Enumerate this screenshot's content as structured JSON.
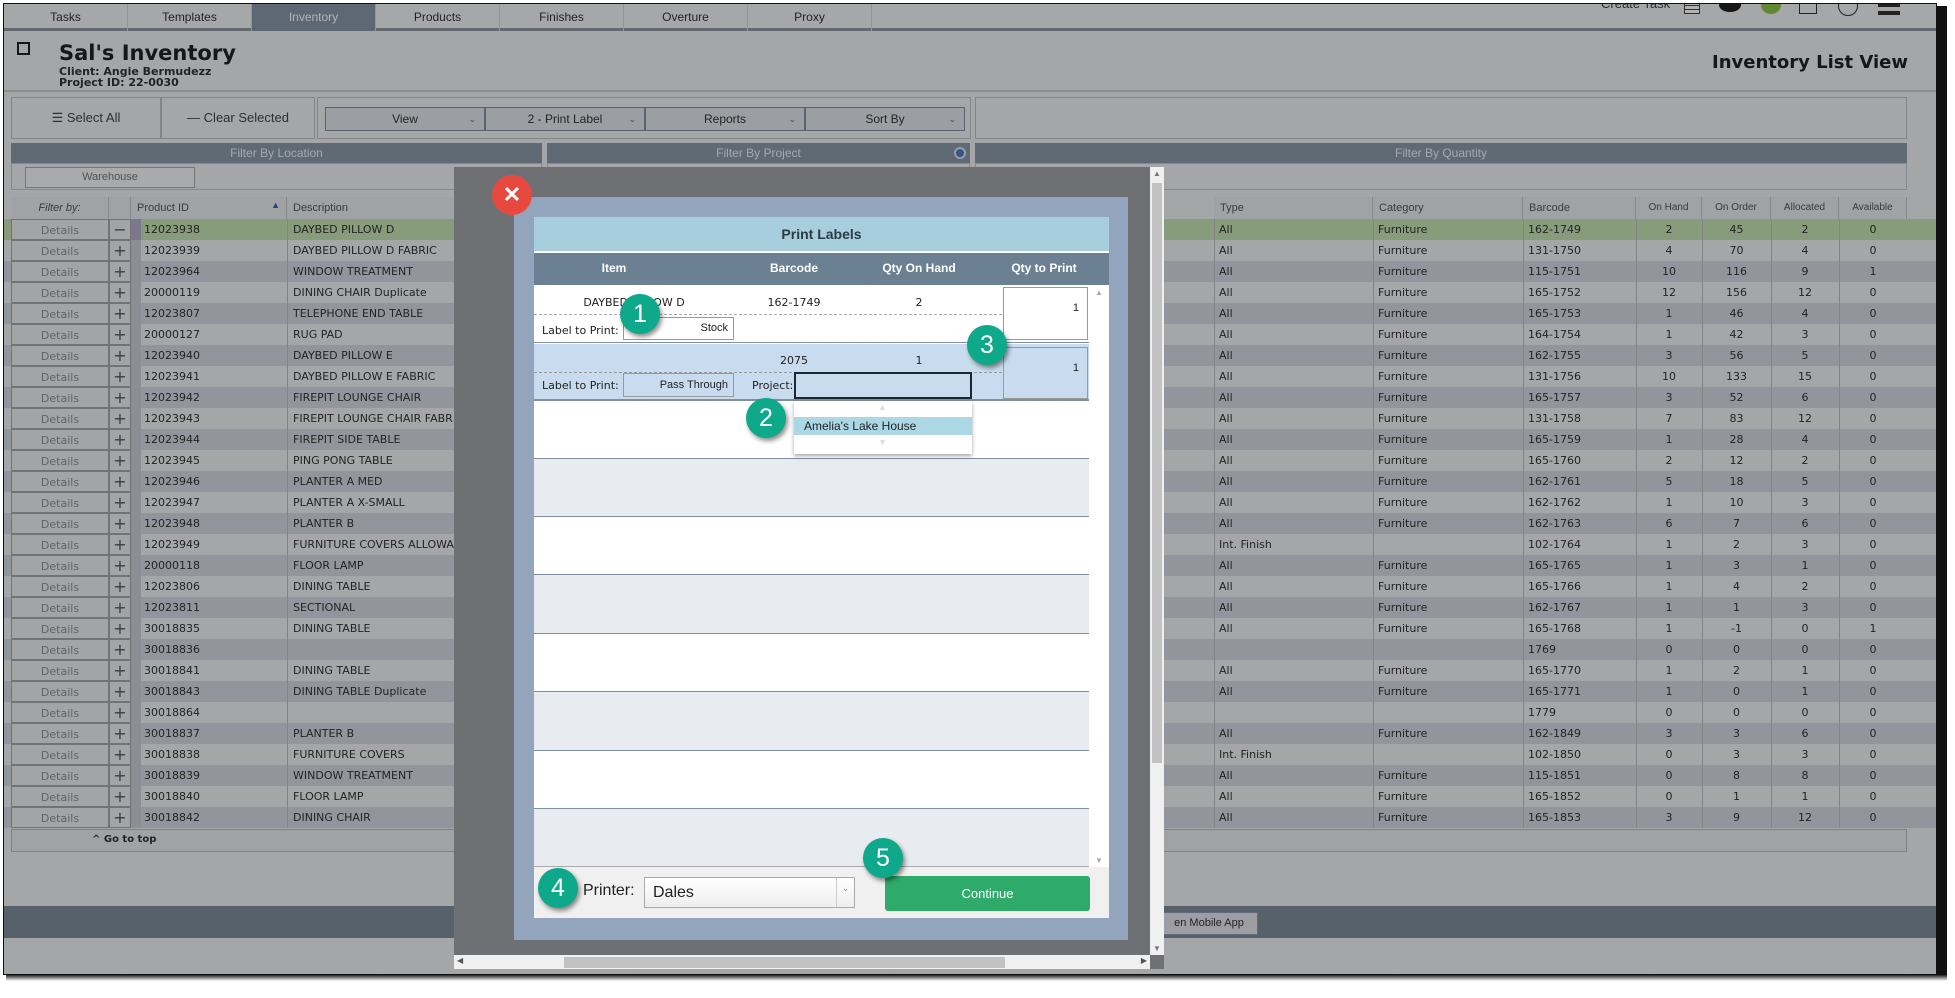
{
  "nav": {
    "tabs": [
      "Tasks",
      "Templates",
      "Inventory",
      "Products",
      "Finishes",
      "Overture",
      "Proxy"
    ],
    "active_tab": "Inventory",
    "create_task": "Create Task"
  },
  "header": {
    "title": "Sal's Inventory",
    "client": "Client: Angie Bermudezz",
    "project_id": "Project ID: 22-0030",
    "view_title": "Inventory List View"
  },
  "toolbar": {
    "select_all": "Select All",
    "clear_selected": "Clear Selected",
    "dropdowns": [
      "View",
      "2 - Print Label",
      "Reports",
      "Sort By"
    ]
  },
  "filters": {
    "location": "Filter By Location",
    "project": "Filter By Project",
    "quantity": "Filter By Quantity",
    "warehouse": "Warehouse"
  },
  "table": {
    "headers": {
      "filter_by": "Filter by:",
      "product_id": "Product ID",
      "description": "Description",
      "type": "Type",
      "category": "Category",
      "barcode": "Barcode",
      "on_hand": "On Hand",
      "on_order": "On Order",
      "allocated": "Allocated",
      "available": "Available"
    },
    "details_label": "Details",
    "go_to_top": "^ Go to top",
    "rows": [
      {
        "product_id": "12023938",
        "description": "DAYBED PILLOW D",
        "type": "All",
        "category": "Furniture",
        "barcode": "162-1749",
        "on_hand": "2",
        "on_order": "45",
        "allocated": "2",
        "available": "0",
        "selected": true
      },
      {
        "product_id": "12023939",
        "description": "DAYBED PILLOW D FABRIC",
        "type": "All",
        "category": "Furniture",
        "barcode": "131-1750",
        "on_hand": "4",
        "on_order": "70",
        "allocated": "4",
        "available": "0"
      },
      {
        "product_id": "12023964",
        "description": "WINDOW TREATMENT",
        "type": "All",
        "category": "Furniture",
        "barcode": "115-1751",
        "on_hand": "10",
        "on_order": "116",
        "allocated": "9",
        "available": "1"
      },
      {
        "product_id": "20000119",
        "description": "DINING CHAIR Duplicate",
        "type": "All",
        "category": "Furniture",
        "barcode": "165-1752",
        "on_hand": "12",
        "on_order": "156",
        "allocated": "12",
        "available": "0"
      },
      {
        "product_id": "12023807",
        "description": "TELEPHONE END TABLE",
        "type": "All",
        "category": "Furniture",
        "barcode": "165-1753",
        "on_hand": "1",
        "on_order": "46",
        "allocated": "4",
        "available": "0"
      },
      {
        "product_id": "20000127",
        "description": "RUG PAD",
        "type": "All",
        "category": "Furniture",
        "barcode": "164-1754",
        "on_hand": "1",
        "on_order": "42",
        "allocated": "3",
        "available": "0"
      },
      {
        "product_id": "12023940",
        "description": "DAYBED PILLOW E",
        "type": "All",
        "category": "Furniture",
        "barcode": "162-1755",
        "on_hand": "3",
        "on_order": "56",
        "allocated": "5",
        "available": "0"
      },
      {
        "product_id": "12023941",
        "description": "DAYBED PILLOW E FABRIC",
        "type": "All",
        "category": "Furniture",
        "barcode": "131-1756",
        "on_hand": "10",
        "on_order": "133",
        "allocated": "15",
        "available": "0"
      },
      {
        "product_id": "12023942",
        "description": "FIREPIT LOUNGE CHAIR",
        "type": "All",
        "category": "Furniture",
        "barcode": "165-1757",
        "on_hand": "3",
        "on_order": "52",
        "allocated": "6",
        "available": "0"
      },
      {
        "product_id": "12023943",
        "description": "FIREPIT LOUNGE CHAIR FABR",
        "type": "All",
        "category": "Furniture",
        "barcode": "131-1758",
        "on_hand": "7",
        "on_order": "83",
        "allocated": "12",
        "available": "0"
      },
      {
        "product_id": "12023944",
        "description": "FIREPIT SIDE TABLE",
        "type": "All",
        "category": "Furniture",
        "barcode": "165-1759",
        "on_hand": "1",
        "on_order": "28",
        "allocated": "4",
        "available": "0"
      },
      {
        "product_id": "12023945",
        "description": "PING PONG TABLE",
        "type": "All",
        "category": "Furniture",
        "barcode": "165-1760",
        "on_hand": "2",
        "on_order": "12",
        "allocated": "2",
        "available": "0"
      },
      {
        "product_id": "12023946",
        "description": "PLANTER A MED",
        "type": "All",
        "category": "Furniture",
        "barcode": "162-1761",
        "on_hand": "5",
        "on_order": "18",
        "allocated": "5",
        "available": "0"
      },
      {
        "product_id": "12023947",
        "description": "PLANTER A X-SMALL",
        "type": "All",
        "category": "Furniture",
        "barcode": "162-1762",
        "on_hand": "1",
        "on_order": "10",
        "allocated": "3",
        "available": "0"
      },
      {
        "product_id": "12023948",
        "description": "PLANTER B",
        "type": "All",
        "category": "Furniture",
        "barcode": "162-1763",
        "on_hand": "6",
        "on_order": "7",
        "allocated": "6",
        "available": "0"
      },
      {
        "product_id": "12023949",
        "description": "FURNITURE COVERS ALLOWA",
        "type": "Int. Finish",
        "category": "",
        "barcode": "102-1764",
        "on_hand": "1",
        "on_order": "2",
        "allocated": "3",
        "available": "0"
      },
      {
        "product_id": "20000118",
        "description": "FLOOR LAMP",
        "type": "All",
        "category": "Furniture",
        "barcode": "165-1765",
        "on_hand": "1",
        "on_order": "3",
        "allocated": "1",
        "available": "0"
      },
      {
        "product_id": "12023806",
        "description": "DINING TABLE",
        "type": "All",
        "category": "Furniture",
        "barcode": "165-1766",
        "on_hand": "1",
        "on_order": "4",
        "allocated": "2",
        "available": "0"
      },
      {
        "product_id": "12023811",
        "description": "SECTIONAL",
        "type": "All",
        "category": "Furniture",
        "barcode": "162-1767",
        "on_hand": "1",
        "on_order": "1",
        "allocated": "3",
        "available": "0"
      },
      {
        "product_id": "30018835",
        "description": "DINING TABLE",
        "type": "All",
        "category": "Furniture",
        "barcode": "165-1768",
        "on_hand": "1",
        "on_order": "-1",
        "allocated": "0",
        "available": "1"
      },
      {
        "product_id": "30018836",
        "description": "",
        "type": "",
        "category": "",
        "barcode": "1769",
        "on_hand": "0",
        "on_order": "0",
        "allocated": "0",
        "available": "0"
      },
      {
        "product_id": "30018841",
        "description": "DINING TABLE",
        "type": "All",
        "category": "Furniture",
        "barcode": "165-1770",
        "on_hand": "1",
        "on_order": "2",
        "allocated": "1",
        "available": "0"
      },
      {
        "product_id": "30018843",
        "description": "DINING TABLE Duplicate",
        "type": "All",
        "category": "Furniture",
        "barcode": "165-1771",
        "on_hand": "1",
        "on_order": "0",
        "allocated": "1",
        "available": "0"
      },
      {
        "product_id": "30018864",
        "description": "",
        "type": "",
        "category": "",
        "barcode": "1779",
        "on_hand": "0",
        "on_order": "0",
        "allocated": "0",
        "available": "0"
      },
      {
        "product_id": "30018837",
        "description": "PLANTER B",
        "type": "All",
        "category": "Furniture",
        "barcode": "162-1849",
        "on_hand": "3",
        "on_order": "3",
        "allocated": "6",
        "available": "0"
      },
      {
        "product_id": "30018838",
        "description": "FURNITURE COVERS",
        "type": "Int. Finish",
        "category": "",
        "barcode": "102-1850",
        "on_hand": "0",
        "on_order": "3",
        "allocated": "3",
        "available": "0"
      },
      {
        "product_id": "30018839",
        "description": "WINDOW TREATMENT",
        "type": "All",
        "category": "Furniture",
        "barcode": "115-1851",
        "on_hand": "0",
        "on_order": "8",
        "allocated": "8",
        "available": "0"
      },
      {
        "product_id": "30018840",
        "description": "FLOOR LAMP",
        "type": "All",
        "category": "Furniture",
        "barcode": "165-1852",
        "on_hand": "0",
        "on_order": "1",
        "allocated": "1",
        "available": "0"
      },
      {
        "product_id": "30018842",
        "description": "DINING CHAIR",
        "type": "All",
        "category": "Furniture",
        "barcode": "165-1853",
        "on_hand": "3",
        "on_order": "9",
        "allocated": "12",
        "available": "0"
      }
    ]
  },
  "footer": {
    "mobile_app": "en Mobile App"
  },
  "modal": {
    "title": "Print Labels",
    "columns": [
      "Item",
      "Barcode",
      "Qty On Hand",
      "Qty to Print"
    ],
    "items": [
      {
        "item": "DAYBED PILLOW D",
        "barcode": "162-1749",
        "qty_on_hand": "2",
        "label_to_print_label": "Label to Print:",
        "label_to_print": "Stock",
        "qty_to_print": "1"
      },
      {
        "item": "",
        "barcode": "2075",
        "qty_on_hand": "1",
        "label_to_print_label": "Label to Print:",
        "label_to_print": "Pass Through",
        "project_label": "Project:",
        "project_value": "",
        "qty_to_print": "1"
      }
    ],
    "project_options": [
      "Amelia's Lake House"
    ],
    "printer_label": "Printer:",
    "printer_value": "Dales",
    "continue_label": "Continue",
    "badges": [
      "1",
      "2",
      "3",
      "4",
      "5"
    ]
  },
  "colors": {
    "accent_green": "#2eaa6a",
    "badge_teal": "#0ea88b",
    "close_red": "#e8493f",
    "header_slate": "#6b8193",
    "title_blue": "#a6cedd"
  }
}
